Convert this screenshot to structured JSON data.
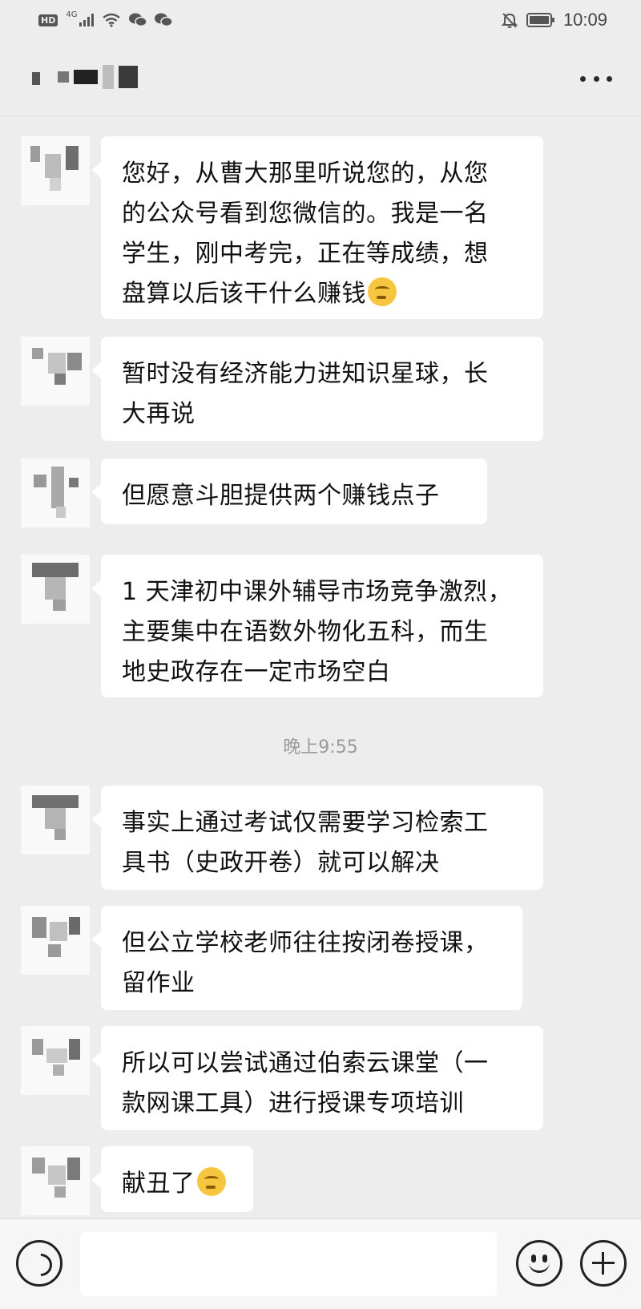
{
  "status_bar": {
    "network_badge": "HD",
    "network_type": "4G",
    "time": "10:09",
    "icons": [
      "hd-icon",
      "signal-icon",
      "wifi-icon",
      "wechat-icon",
      "wechat-icon",
      "mute-icon",
      "battery-icon"
    ]
  },
  "header": {
    "more_icon": "more-dots-icon"
  },
  "messages": [
    {
      "lines": [
        "您好，从曹大那里听说您的，从您",
        "的公众号看到您微信的。我是一名",
        "学生，刚中考完，正在等成绩，想",
        "盘算以后该干什么赚钱"
      ],
      "emoji": "thinking-face-emoji"
    },
    {
      "lines": [
        "暂时没有经济能力进知识星球，长",
        "大再说"
      ]
    },
    {
      "lines": [
        "但愿意斗胆提供两个赚钱点子"
      ]
    },
    {
      "lines": [
        "1 天津初中课外辅导市场竞争激烈，",
        "主要集中在语数外物化五科，而生",
        "地史政存在一定市场空白"
      ]
    },
    {
      "lines": [
        "事实上通过考试仅需要学习检索工",
        "具书（史政开卷）就可以解决"
      ]
    },
    {
      "lines": [
        "但公立学校老师往往按闭卷授课，",
        "留作业"
      ]
    },
    {
      "lines": [
        "所以可以尝试通过伯索云课堂（一",
        "款网课工具）进行授课专项培训"
      ]
    },
    {
      "lines": [
        "献丑了"
      ],
      "emoji": "thinking-face-emoji"
    }
  ],
  "timestamp": "晚上9:55",
  "input_bar": {
    "placeholder": "",
    "icons": [
      "voice-icon",
      "emoji-icon",
      "plus-icon"
    ]
  }
}
